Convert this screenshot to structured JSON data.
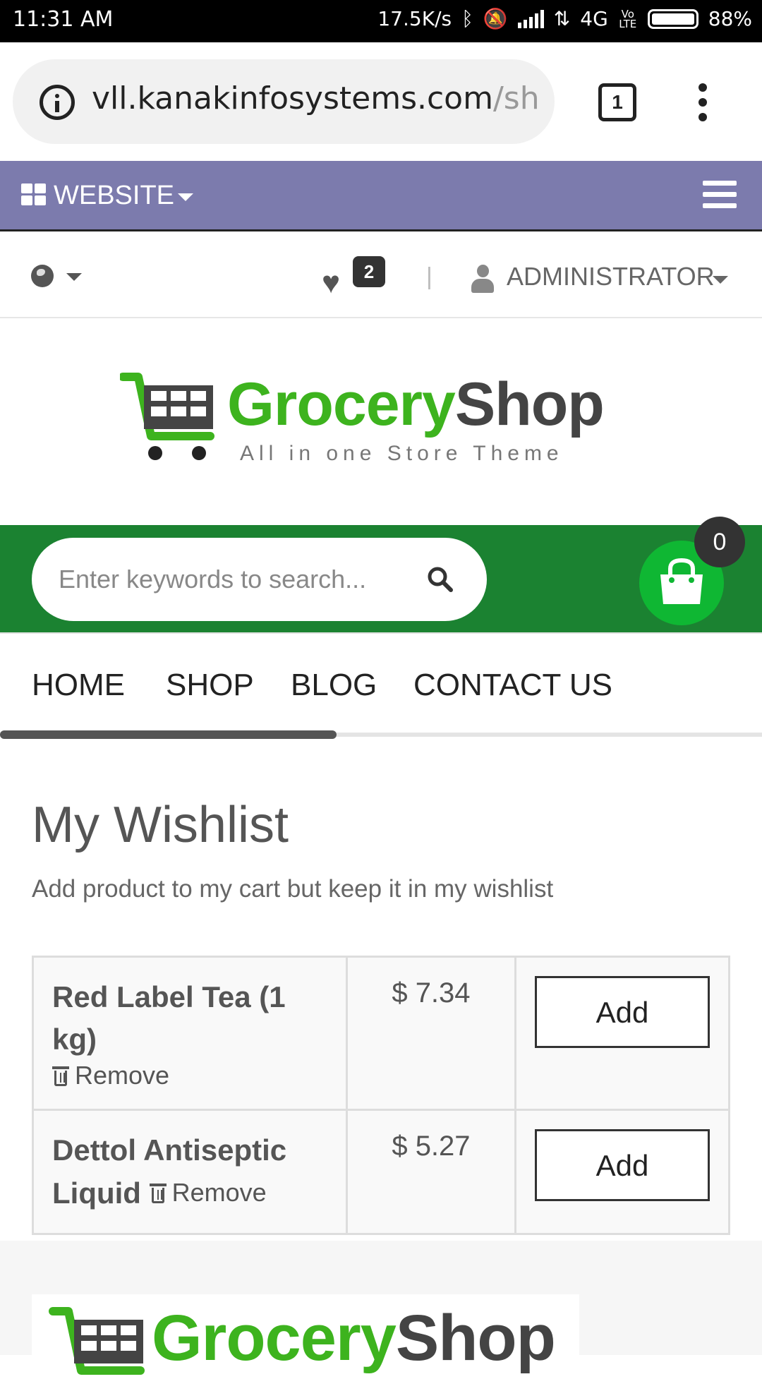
{
  "status_bar": {
    "time": "11:31 AM",
    "net_speed": "17.5K/s",
    "network": "4G",
    "volte": "Vo LTE",
    "battery": "88%"
  },
  "browser": {
    "url_main": "vll.kanakinfosystems.com",
    "url_rest": "/sh",
    "tab_count": "1"
  },
  "website_bar": {
    "label": "WEBSITE"
  },
  "utility": {
    "wishlist_count": "2",
    "separator": "|",
    "user": "ADMINISTRATOR"
  },
  "logo": {
    "part1": "Grocery",
    "part2": "Shop",
    "tagline": "All in one Store Theme"
  },
  "search": {
    "placeholder": "Enter keywords to search..."
  },
  "cart": {
    "count": "0"
  },
  "nav": {
    "items": [
      "HOME",
      "SHOP",
      "BLOG",
      "CONTACT US"
    ]
  },
  "page": {
    "title": "My Wishlist",
    "subtitle": "Add product to my cart but keep it in my wishlist"
  },
  "wishlist": {
    "remove_label": "Remove",
    "add_label": "Add",
    "items": [
      {
        "name": "Red Label Tea (1 kg)",
        "price": "$ 7.34"
      },
      {
        "name": "Dettol Antiseptic Liquid",
        "price": "$ 5.27"
      }
    ]
  },
  "colors": {
    "website_bar": "#7c7bad",
    "green_bar": "#1b8231",
    "cart_button": "#0fb733",
    "logo_green": "#3db31e"
  }
}
